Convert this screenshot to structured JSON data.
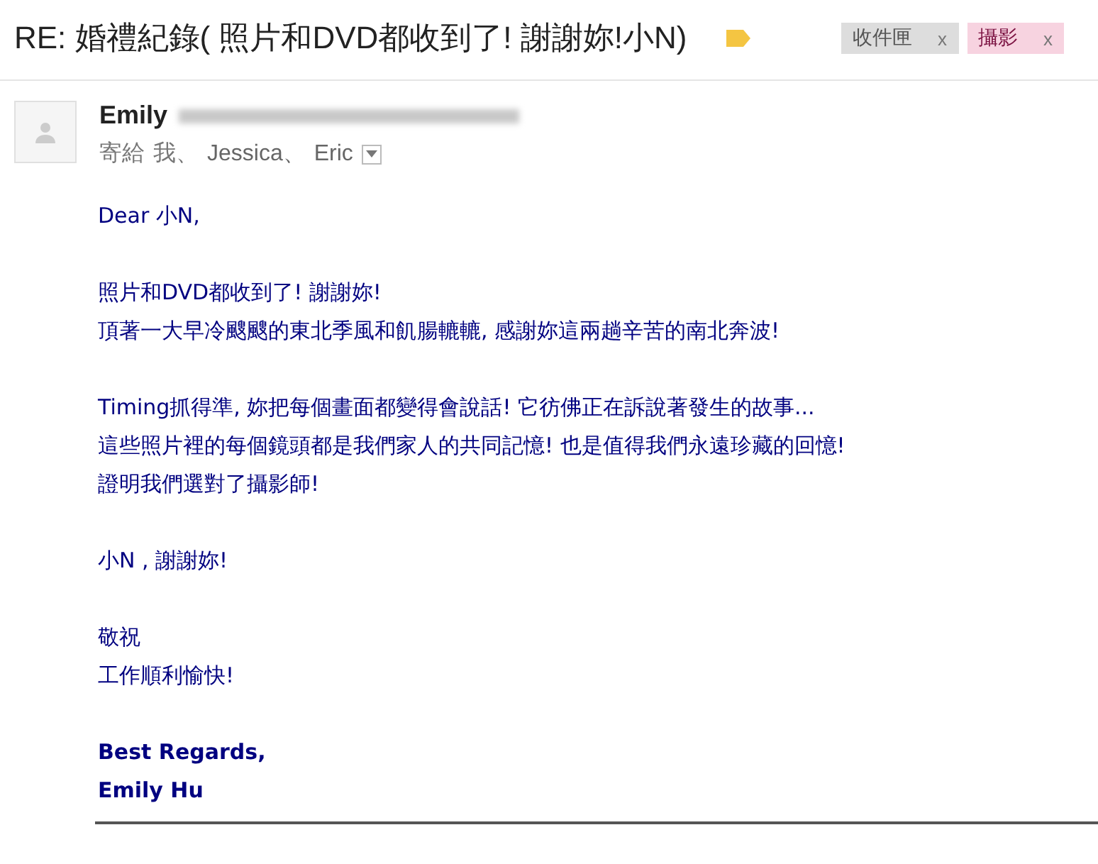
{
  "subject": "RE: 婚禮紀錄( 照片和DVD都收到了! 謝謝妳!小N)",
  "important": true,
  "labels": [
    {
      "text": "收件匣",
      "remove": "x",
      "color": "#dddddd"
    },
    {
      "text": "攝影",
      "remove": "x",
      "color": "#f7d3e0"
    }
  ],
  "sender": {
    "name": "Emily",
    "address_redacted": true
  },
  "recipients": {
    "prefix": "寄給",
    "separator": "、",
    "names": [
      "我",
      "Jessica",
      "Eric"
    ]
  },
  "body": {
    "greeting": "Dear 小N,",
    "paragraphs": [
      [
        "照片和DVD都收到了! 謝謝妳!",
        "頂著一大早冷颼颼的東北季風和飢腸轆轆, 感謝妳這兩趟辛苦的南北奔波!"
      ],
      [
        "Timing抓得準, 妳把每個畫面都變得會說話! 它彷佛正在訴說著發生的故事...",
        "這些照片裡的每個鏡頭都是我們家人的共同記憶! 也是值得我們永遠珍藏的回憶!",
        "證明我們選對了攝影師!"
      ],
      [
        "小N , 謝謝妳!"
      ],
      [
        "敬祝",
        "工作順利愉快!"
      ]
    ],
    "signature": [
      "Best Regards,",
      "Emily Hu"
    ]
  }
}
